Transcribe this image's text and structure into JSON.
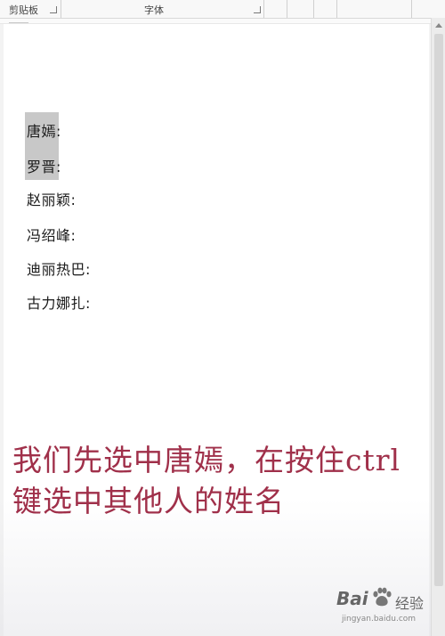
{
  "ribbon": {
    "clipboard_label": "剪贴板",
    "font_label": "字体"
  },
  "document": {
    "names": [
      "唐嫣:",
      "罗晋:",
      "赵丽颖:",
      "冯绍峰:",
      "迪丽热巴:",
      "古力娜扎:"
    ]
  },
  "caption": {
    "line1": "我们先选中唐嫣，在按住ctrl",
    "line2": "键选中其他人的姓名"
  },
  "watermark": {
    "brand": "Bai",
    "brand_cn": "经验",
    "url": "jingyan.baidu.com"
  },
  "colors": {
    "caption": "#a0304a",
    "selection": "#c8c8c8"
  }
}
